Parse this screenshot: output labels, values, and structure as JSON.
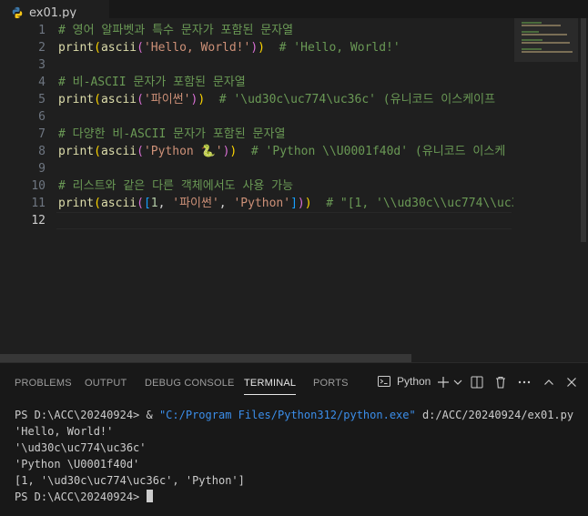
{
  "tab": {
    "filename": "ex01.py",
    "icon": "python-icon"
  },
  "editor": {
    "line_numbers": [
      "1",
      "2",
      "3",
      "4",
      "5",
      "6",
      "7",
      "8",
      "9",
      "10",
      "11",
      "12"
    ],
    "active_line": 12,
    "lines": [
      [
        {
          "t": "# 영어 알파벳과 특수 문자가 포함된 문자열",
          "c": "comment"
        }
      ],
      [
        {
          "t": "print",
          "c": "fn"
        },
        {
          "t": "(",
          "c": "p1"
        },
        {
          "t": "ascii",
          "c": "fn"
        },
        {
          "t": "(",
          "c": "p2"
        },
        {
          "t": "'Hello, World!'",
          "c": "str"
        },
        {
          "t": ")",
          "c": "p2"
        },
        {
          "t": ")",
          "c": "p1"
        },
        {
          "t": "  ",
          "c": "plain"
        },
        {
          "t": "# 'Hello, World!'",
          "c": "comment"
        }
      ],
      [],
      [
        {
          "t": "# 비-ASCII 문자가 포함된 문자열",
          "c": "comment"
        }
      ],
      [
        {
          "t": "print",
          "c": "fn"
        },
        {
          "t": "(",
          "c": "p1"
        },
        {
          "t": "ascii",
          "c": "fn"
        },
        {
          "t": "(",
          "c": "p2"
        },
        {
          "t": "'파이썬'",
          "c": "str"
        },
        {
          "t": ")",
          "c": "p2"
        },
        {
          "t": ")",
          "c": "p1"
        },
        {
          "t": "  ",
          "c": "plain"
        },
        {
          "t": "# '\\ud30c\\uc774\\uc36c' (유니코드 이스케이프",
          "c": "comment"
        }
      ],
      [],
      [
        {
          "t": "# 다양한 비-ASCII 문자가 포함된 문자열",
          "c": "comment"
        }
      ],
      [
        {
          "t": "print",
          "c": "fn"
        },
        {
          "t": "(",
          "c": "p1"
        },
        {
          "t": "ascii",
          "c": "fn"
        },
        {
          "t": "(",
          "c": "p2"
        },
        {
          "t": "'Python ",
          "c": "str"
        },
        {
          "t": "🐍",
          "c": "emoji"
        },
        {
          "t": "'",
          "c": "str"
        },
        {
          "t": ")",
          "c": "p2"
        },
        {
          "t": ")",
          "c": "p1"
        },
        {
          "t": "  ",
          "c": "plain"
        },
        {
          "t": "# 'Python \\\\U0001f40d' (유니코드 이스케",
          "c": "comment"
        }
      ],
      [],
      [
        {
          "t": "# 리스트와 같은 다른 객체에서도 사용 가능",
          "c": "comment"
        }
      ],
      [
        {
          "t": "print",
          "c": "fn"
        },
        {
          "t": "(",
          "c": "p1"
        },
        {
          "t": "ascii",
          "c": "fn"
        },
        {
          "t": "(",
          "c": "p2"
        },
        {
          "t": "[",
          "c": "p3"
        },
        {
          "t": "1",
          "c": "num"
        },
        {
          "t": ", ",
          "c": "plain"
        },
        {
          "t": "'파이썬'",
          "c": "str"
        },
        {
          "t": ", ",
          "c": "plain"
        },
        {
          "t": "'Python'",
          "c": "str"
        },
        {
          "t": "]",
          "c": "p3"
        },
        {
          "t": ")",
          "c": "p2"
        },
        {
          "t": ")",
          "c": "p1"
        },
        {
          "t": "  ",
          "c": "plain"
        },
        {
          "t": "# \"[1, '\\\\ud30c\\\\uc774\\\\uc3",
          "c": "comment"
        }
      ],
      []
    ]
  },
  "panel": {
    "tabs": [
      "PROBLEMS",
      "OUTPUT",
      "DEBUG CONSOLE",
      "TERMINAL",
      "PORTS"
    ],
    "active_tab": "TERMINAL",
    "terminal_profile": "Python",
    "terminal": {
      "prompt1": "PS D:\\ACC\\20240924> & ",
      "exe_path": "\"C:/Program Files/Python312/python.exe\"",
      "script_path": " d:/ACC/20240924/ex01.py",
      "output": [
        "'Hello, World!'",
        "'\\ud30c\\uc774\\uc36c'",
        "'Python \\U0001f40d'",
        "[1, '\\ud30c\\uc774\\uc36c', 'Python']"
      ],
      "prompt2": "PS D:\\ACC\\20240924> "
    }
  },
  "colors": {
    "comment": "#6a9955",
    "function": "#dcdcaa",
    "string": "#ce9178",
    "number": "#b5cea8",
    "bracket1": "#ffd700",
    "bracket2": "#da70d6",
    "bracket3": "#179fff",
    "path": "#3b8eea",
    "background": "#1f1f1f"
  }
}
